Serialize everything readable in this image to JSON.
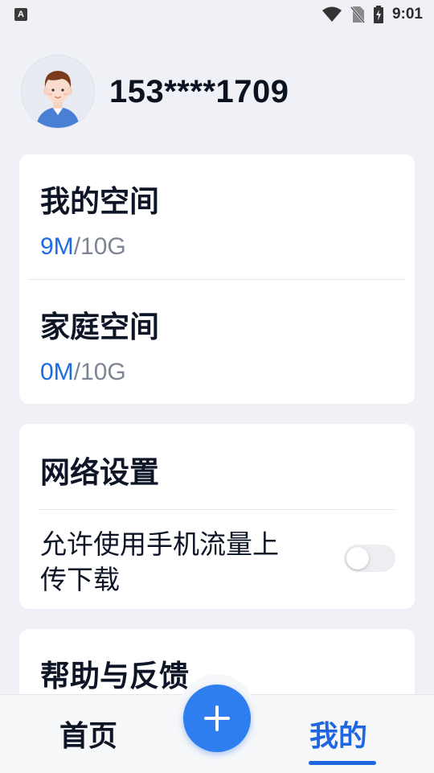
{
  "status_bar": {
    "notification_glyph": "A",
    "time": "9:01",
    "icons": [
      "wifi-icon",
      "no-sim-icon",
      "battery-charging-icon"
    ]
  },
  "profile": {
    "phone": "153****1709",
    "avatar_icon": "user-avatar-icon"
  },
  "storage": {
    "my_space": {
      "title": "我的空间",
      "used": "9M",
      "total": "/10G"
    },
    "family_space": {
      "title": "家庭空间",
      "used": "0M",
      "total": "/10G"
    }
  },
  "network": {
    "title": "网络设置",
    "mobile_data": {
      "label_line1": "允许使用手机流量上",
      "label_line2": "传下载",
      "enabled": false
    }
  },
  "help": {
    "title": "帮助与反馈"
  },
  "tabbar": {
    "home_label": "首页",
    "mine_label": "我的",
    "add_icon": "plus-icon",
    "active": "mine"
  },
  "colors": {
    "accent": "#1f66e0",
    "fab": "#2f7ef0",
    "background": "#f0f1f6"
  }
}
